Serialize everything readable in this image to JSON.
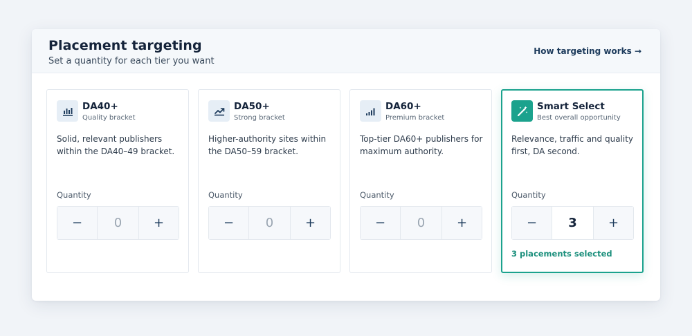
{
  "header": {
    "title": "Placement targeting",
    "subtitle": "Set a quantity for each tier you want",
    "help_link": "How targeting works →"
  },
  "colors": {
    "accent": "#1ba28d",
    "badge_bg": "#e6eef6",
    "text_dark": "#14233a"
  },
  "tiers": [
    {
      "name": "DA40+",
      "subtitle": "Quality bracket",
      "icon": "bar-chart-icon",
      "description": "Solid, relevant publishers within the DA40–49 bracket.",
      "quantity_label": "Quantity",
      "quantity": "0",
      "decrement": "−",
      "increment": "+"
    },
    {
      "name": "DA50+",
      "subtitle": "Strong bracket",
      "icon": "trend-up-icon",
      "description": "Higher-authority sites within the DA50–59 bracket.",
      "quantity_label": "Quantity",
      "quantity": "0",
      "decrement": "−",
      "increment": "+"
    },
    {
      "name": "DA60+",
      "subtitle": "Premium bracket",
      "icon": "signal-bars-icon",
      "description": "Top-tier DA60+ publishers for maximum authority.",
      "quantity_label": "Quantity",
      "quantity": "0",
      "decrement": "−",
      "increment": "+"
    },
    {
      "name": "Smart Select",
      "subtitle": "Best overall opportunity",
      "icon": "magic-wand-icon",
      "description": "Relevance, traffic and quality first, DA second.",
      "quantity_label": "Quantity",
      "quantity": "3",
      "decrement": "−",
      "increment": "+",
      "selected": true,
      "selected_note": "3 placements selected"
    }
  ]
}
